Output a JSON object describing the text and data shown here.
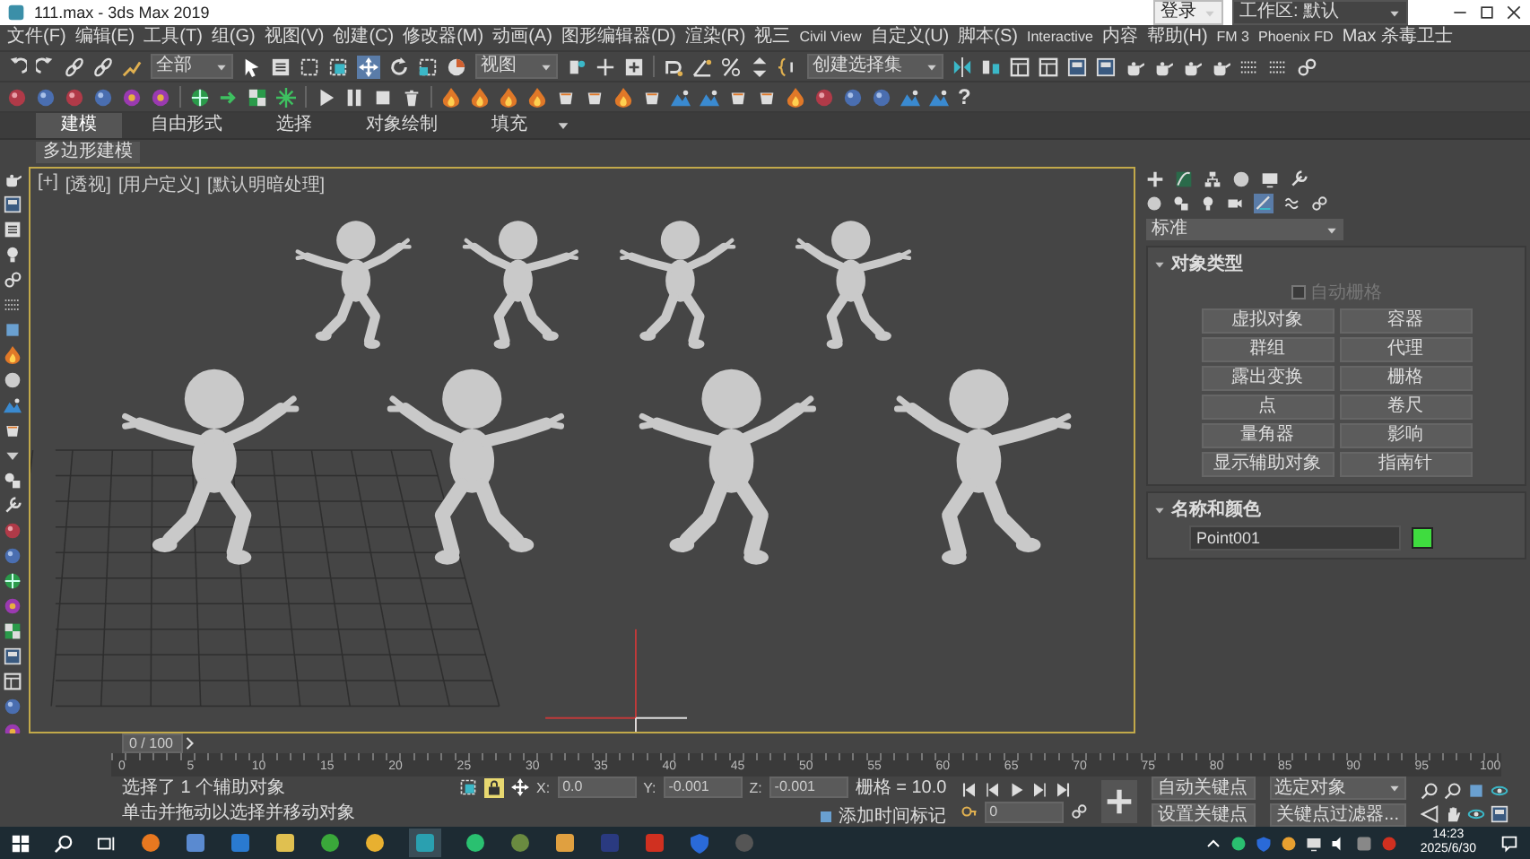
{
  "window": {
    "title": "111.max - 3ds Max 2019"
  },
  "account": {
    "label": "登录"
  },
  "workspace": {
    "label": "工作区: 默认"
  },
  "menu": [
    "文件(F)",
    "编辑(E)",
    "工具(T)",
    "组(G)",
    "视图(V)",
    "创建(C)",
    "修改器(M)",
    "动画(A)",
    "图形编辑器(D)",
    "渲染(R)",
    "视三",
    "Civil View",
    "自定义(U)",
    "脚本(S)",
    "Interactive",
    "内容",
    "帮助(H)",
    "FM 3",
    "Phoenix FD",
    "Max 杀毒卫士"
  ],
  "toolbar": {
    "selection_filter": "全部",
    "reference_coord": "视图",
    "selection_set": "创建选择集",
    "help": "?"
  },
  "ribbon": {
    "tabs": [
      {
        "label": "建模",
        "selected": true
      },
      {
        "label": "自由形式",
        "selected": false
      },
      {
        "label": "选择",
        "selected": false
      },
      {
        "label": "对象绘制",
        "selected": false
      },
      {
        "label": "填充",
        "selected": false
      }
    ],
    "panel_label": "多边形建模"
  },
  "viewport": {
    "labels": [
      "[+]",
      "[透视]",
      "[用户定义]",
      "[默认明暗处理]"
    ]
  },
  "command_panel": {
    "category": "标准",
    "object_type": {
      "title": "对象类型",
      "autogrid": {
        "label": "自动栅格",
        "checked": false,
        "disabled": true
      },
      "buttons": [
        "虚拟对象",
        "容器",
        "群组",
        "代理",
        "露出变换",
        "栅格",
        "点",
        "卷尺",
        "量角器",
        "影响",
        "显示辅助对象",
        "指南针"
      ]
    },
    "name_color": {
      "title": "名称和颜色",
      "name": "Point001",
      "color": "#3fdc3f"
    }
  },
  "timeline": {
    "position": "0 / 100",
    "ticks": [
      "0",
      "5",
      "10",
      "15",
      "20",
      "25",
      "30",
      "35",
      "40",
      "45",
      "50",
      "55",
      "60",
      "65",
      "70",
      "75",
      "80",
      "85",
      "90",
      "95",
      "100"
    ]
  },
  "status": {
    "selection": "选择了 1 个辅助对象",
    "prompt": "单击并拖动以选择并移动对象",
    "coords": [
      {
        "axis": "X:",
        "value": "0.0"
      },
      {
        "axis": "Y:",
        "value": "-0.001"
      },
      {
        "axis": "Z:",
        "value": "-0.001"
      }
    ],
    "grid": "栅格 = 10.0",
    "add_time_tag": "添加时间标记",
    "frame": "0",
    "auto_key": "自动关键点",
    "key_mode": "选定对象",
    "set_key": "设置关键点",
    "key_filters": "关键点过滤器..."
  },
  "taskbar": {
    "time": "14:23",
    "date": "2025/6/30"
  }
}
